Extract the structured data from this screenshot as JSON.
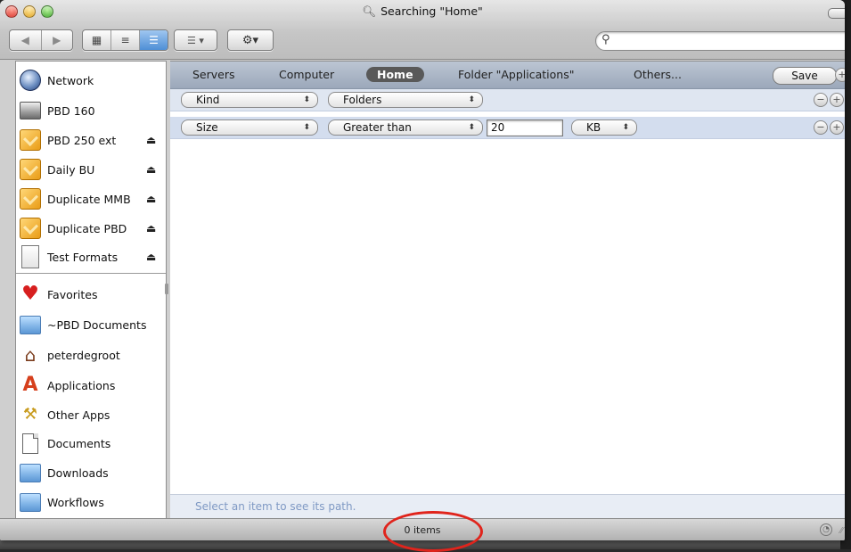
{
  "window": {
    "title": "Searching \"Home\""
  },
  "toolbar": {
    "back_icon": "back-arrow-icon",
    "forward_icon": "forward-arrow-icon",
    "arrange_icon": "arrange-icon",
    "action_icon": "gear-icon",
    "search_placeholder": ""
  },
  "sidebar": {
    "devices": [
      {
        "label": "Network",
        "icon": "network-globe-icon",
        "eject": ""
      },
      {
        "label": "PBD 160",
        "icon": "hard-disk-icon",
        "eject": ""
      },
      {
        "label": "PBD 250 ext",
        "icon": "external-drive-icon",
        "eject": "⏏"
      },
      {
        "label": "Daily BU",
        "icon": "external-drive-icon",
        "eject": "⏏"
      },
      {
        "label": "Duplicate MMB",
        "icon": "external-drive-icon",
        "eject": "⏏"
      },
      {
        "label": "Duplicate PBD",
        "icon": "external-drive-icon",
        "eject": "⏏"
      },
      {
        "label": "Test Formats",
        "icon": "disk-image-icon",
        "eject": "⏏"
      }
    ],
    "places": [
      {
        "label": "Favorites",
        "icon": "heart-icon"
      },
      {
        "label": "~PBD Documents",
        "icon": "folder-icon"
      },
      {
        "label": "peterdegroot",
        "icon": "home-icon"
      },
      {
        "label": "Applications",
        "icon": "applications-icon"
      },
      {
        "label": "Other Apps",
        "icon": "tools-icon"
      },
      {
        "label": "Documents",
        "icon": "document-icon"
      },
      {
        "label": "Downloads",
        "icon": "folder-icon"
      },
      {
        "label": "Workflows",
        "icon": "folder-icon"
      }
    ]
  },
  "scope": {
    "servers": "Servers",
    "computer": "Computer",
    "home": "Home",
    "folder": "Folder \"Applications\"",
    "others": "Others...",
    "save": "Save",
    "add": "+"
  },
  "criteria": [
    {
      "attribute": "Kind",
      "operator": "Folders",
      "value": "",
      "unit": ""
    },
    {
      "attribute": "Size",
      "operator": "Greater than",
      "value": "20",
      "unit": "KB"
    }
  ],
  "path_hint": "Select an item to see its path.",
  "status": {
    "items": "0 items"
  },
  "colors": {
    "annotation": "#e0241c",
    "selected_scope": "#595959"
  }
}
